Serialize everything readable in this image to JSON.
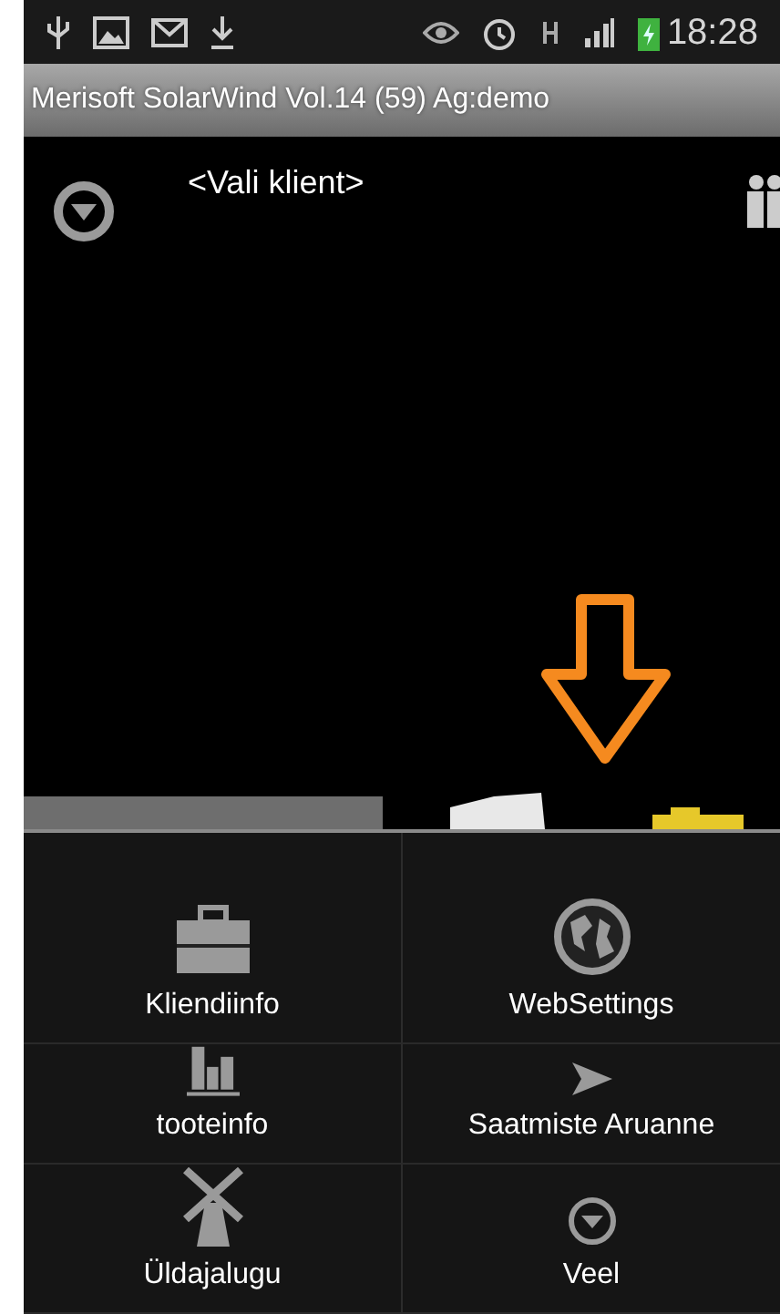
{
  "status_bar": {
    "time": "18:28"
  },
  "app_title": "Merisoft SolarWind Vol.14 (59) Ag:demo",
  "client_selector": {
    "label": "<Vali klient>"
  },
  "menu": [
    {
      "kind": "briefcase",
      "label": "Kliendiinfo"
    },
    {
      "kind": "globe",
      "label": "WebSettings"
    },
    {
      "kind": "chart",
      "label": "tooteinfo"
    },
    {
      "kind": "send",
      "label": "Saatmiste Aruanne"
    },
    {
      "kind": "windmill",
      "label": "Üldajalugu"
    },
    {
      "kind": "more",
      "label": "Veel"
    }
  ]
}
